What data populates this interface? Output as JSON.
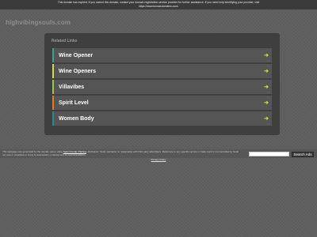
{
  "notice": {
    "line1": "This domain has expired. If you owned this domain, contact your domain registration service provider for further assistance. If you need help identifying your provider, visit",
    "line2": "https://www.tucowsdomains.com/"
  },
  "header": {
    "domain": "highvibingsouls.com"
  },
  "related": {
    "title": "Related Links",
    "items": [
      {
        "label": "Wine Opener",
        "color": "#3aa38f",
        "icon": "arrow-right-icon"
      },
      {
        "label": "Wine Openers",
        "color": "#d8d84a",
        "icon": "arrow-right-icon"
      },
      {
        "label": "Villavibes",
        "color": "#9cc84a",
        "icon": "arrow-right-icon"
      },
      {
        "label": "Spirit Level",
        "color": "#e07a2a",
        "icon": "arrow-right-icon"
      },
      {
        "label": "Women Body",
        "color": "#2a8a8a",
        "icon": "arrow-right-icon"
      }
    ]
  },
  "footer": {
    "text_before": "This webpage was generated by the domain owner using ",
    "link_text": "Sedo Domain Parking",
    "text_after": ". Disclaimer: Sedo maintains no relationship with third party advertisers. Reference to any specific service or trade mark is not controlled by Sedo nor does it constitute or imply its association, endorsement or recommendation.",
    "search_placeholder": "",
    "search_button": "Search Ads",
    "privacy": "Privacy Policy"
  }
}
